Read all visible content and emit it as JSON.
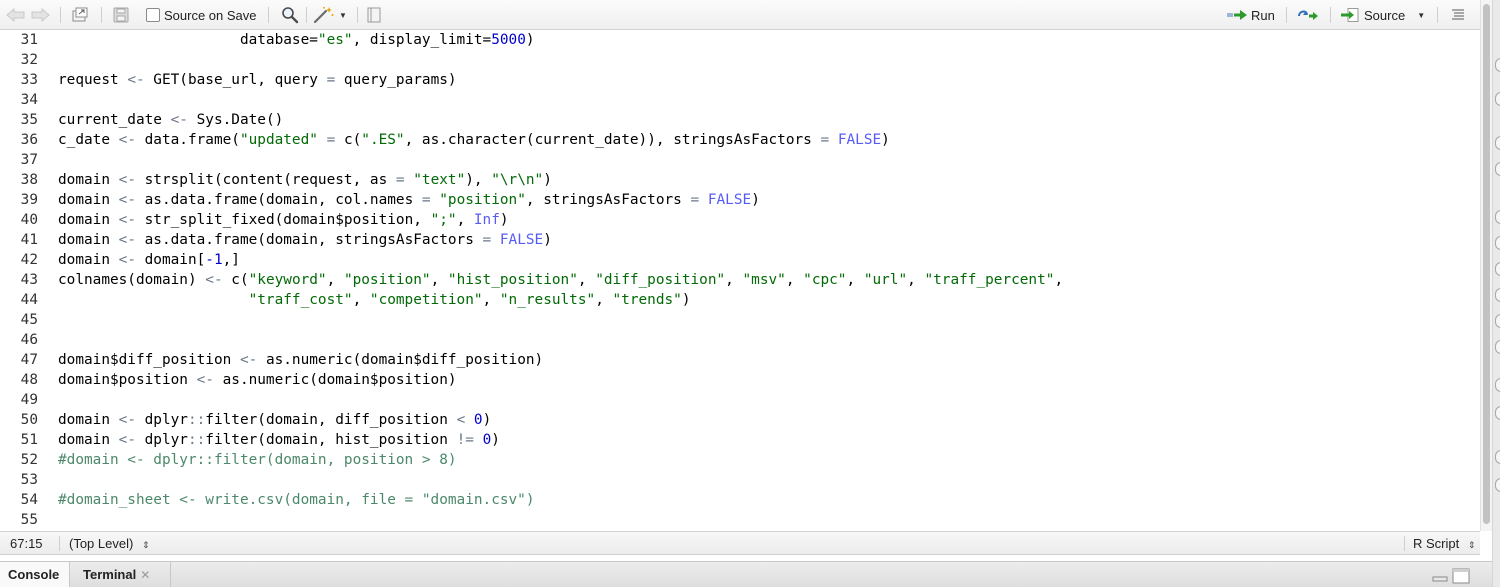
{
  "toolbar": {
    "source_on_save_label": "Source on Save",
    "run_label": "Run",
    "source_label": "Source"
  },
  "editor": {
    "lines": [
      {
        "n": "31",
        "tokens": [
          [
            "",
            "                     database="
          ],
          [
            "str",
            "\"es\""
          ],
          [
            "",
            ", display_limit="
          ],
          [
            "num",
            "5000"
          ],
          [
            "",
            ")"
          ]
        ]
      },
      {
        "n": "32",
        "tokens": []
      },
      {
        "n": "33",
        "tokens": [
          [
            "",
            "request "
          ],
          [
            "op",
            "<-"
          ],
          [
            "",
            " GET(base_url, query "
          ],
          [
            "op",
            "="
          ],
          [
            "",
            " query_params)"
          ]
        ]
      },
      {
        "n": "34",
        "tokens": []
      },
      {
        "n": "35",
        "tokens": [
          [
            "",
            "current_date "
          ],
          [
            "op",
            "<-"
          ],
          [
            "",
            " Sys.Date()"
          ]
        ]
      },
      {
        "n": "36",
        "tokens": [
          [
            "",
            "c_date "
          ],
          [
            "op",
            "<-"
          ],
          [
            "",
            " data.frame("
          ],
          [
            "str",
            "\"updated\""
          ],
          [
            "",
            " "
          ],
          [
            "op",
            "="
          ],
          [
            "",
            " c("
          ],
          [
            "str",
            "\".ES\""
          ],
          [
            "",
            ", as.character(current_date)), stringsAsFactors "
          ],
          [
            "op",
            "="
          ],
          [
            "",
            " "
          ],
          [
            "const",
            "FALSE"
          ],
          [
            "",
            ")"
          ]
        ]
      },
      {
        "n": "37",
        "tokens": []
      },
      {
        "n": "38",
        "tokens": [
          [
            "",
            "domain "
          ],
          [
            "op",
            "<-"
          ],
          [
            "",
            " strsplit(content(request, as "
          ],
          [
            "op",
            "="
          ],
          [
            "",
            " "
          ],
          [
            "str",
            "\"text\""
          ],
          [
            "",
            "), "
          ],
          [
            "str",
            "\"\\r\\n\""
          ],
          [
            "",
            ")"
          ]
        ]
      },
      {
        "n": "39",
        "tokens": [
          [
            "",
            "domain "
          ],
          [
            "op",
            "<-"
          ],
          [
            "",
            " as.data.frame(domain, col.names "
          ],
          [
            "op",
            "="
          ],
          [
            "",
            " "
          ],
          [
            "str",
            "\"position\""
          ],
          [
            "",
            ", stringsAsFactors "
          ],
          [
            "op",
            "="
          ],
          [
            "",
            " "
          ],
          [
            "const",
            "FALSE"
          ],
          [
            "",
            ")"
          ]
        ]
      },
      {
        "n": "40",
        "tokens": [
          [
            "",
            "domain "
          ],
          [
            "op",
            "<-"
          ],
          [
            "",
            " str_split_fixed(domain$position, "
          ],
          [
            "str",
            "\";\""
          ],
          [
            "",
            ", "
          ],
          [
            "const",
            "Inf"
          ],
          [
            "",
            ")"
          ]
        ]
      },
      {
        "n": "41",
        "tokens": [
          [
            "",
            "domain "
          ],
          [
            "op",
            "<-"
          ],
          [
            "",
            " as.data.frame(domain, stringsAsFactors "
          ],
          [
            "op",
            "="
          ],
          [
            "",
            " "
          ],
          [
            "const",
            "FALSE"
          ],
          [
            "",
            ")"
          ]
        ]
      },
      {
        "n": "42",
        "tokens": [
          [
            "",
            "domain "
          ],
          [
            "op",
            "<-"
          ],
          [
            "",
            " domain["
          ],
          [
            "num",
            "-1"
          ],
          [
            "",
            ",]"
          ]
        ]
      },
      {
        "n": "43",
        "tokens": [
          [
            "",
            "colnames(domain) "
          ],
          [
            "op",
            "<-"
          ],
          [
            "",
            " c("
          ],
          [
            "str",
            "\"keyword\""
          ],
          [
            "",
            ", "
          ],
          [
            "str",
            "\"position\""
          ],
          [
            "",
            ", "
          ],
          [
            "str",
            "\"hist_position\""
          ],
          [
            "",
            ", "
          ],
          [
            "str",
            "\"diff_position\""
          ],
          [
            "",
            ", "
          ],
          [
            "str",
            "\"msv\""
          ],
          [
            "",
            ", "
          ],
          [
            "str",
            "\"cpc\""
          ],
          [
            "",
            ", "
          ],
          [
            "str",
            "\"url\""
          ],
          [
            "",
            ", "
          ],
          [
            "str",
            "\"traff_percent\""
          ],
          [
            "",
            ","
          ]
        ]
      },
      {
        "n": "44",
        "tokens": [
          [
            "",
            "                      "
          ],
          [
            "str",
            "\"traff_cost\""
          ],
          [
            "",
            ", "
          ],
          [
            "str",
            "\"competition\""
          ],
          [
            "",
            ", "
          ],
          [
            "str",
            "\"n_results\""
          ],
          [
            "",
            ", "
          ],
          [
            "str",
            "\"trends\""
          ],
          [
            "",
            ")"
          ]
        ]
      },
      {
        "n": "45",
        "tokens": []
      },
      {
        "n": "46",
        "tokens": []
      },
      {
        "n": "47",
        "tokens": [
          [
            "",
            "domain$diff_position "
          ],
          [
            "op",
            "<-"
          ],
          [
            "",
            " as.numeric(domain$diff_position)"
          ]
        ]
      },
      {
        "n": "48",
        "tokens": [
          [
            "",
            "domain$position "
          ],
          [
            "op",
            "<-"
          ],
          [
            "",
            " as.numeric(domain$position)"
          ]
        ]
      },
      {
        "n": "49",
        "tokens": []
      },
      {
        "n": "50",
        "tokens": [
          [
            "",
            "domain "
          ],
          [
            "op",
            "<-"
          ],
          [
            "",
            " dplyr"
          ],
          [
            "op",
            "::"
          ],
          [
            "",
            "filter(domain, diff_position "
          ],
          [
            "op",
            "<"
          ],
          [
            "",
            " "
          ],
          [
            "num",
            "0"
          ],
          [
            "",
            ")"
          ]
        ]
      },
      {
        "n": "51",
        "tokens": [
          [
            "",
            "domain "
          ],
          [
            "op",
            "<-"
          ],
          [
            "",
            " dplyr"
          ],
          [
            "op",
            "::"
          ],
          [
            "",
            "filter(domain, hist_position "
          ],
          [
            "op",
            "!="
          ],
          [
            "",
            " "
          ],
          [
            "num",
            "0"
          ],
          [
            "",
            ")"
          ]
        ]
      },
      {
        "n": "52",
        "tokens": [
          [
            "cmt",
            "#domain <- dplyr::filter(domain, position > 8)"
          ]
        ]
      },
      {
        "n": "53",
        "tokens": []
      },
      {
        "n": "54",
        "tokens": [
          [
            "cmt",
            "#domain_sheet <- write.csv(domain, file = \"domain.csv\")"
          ]
        ]
      },
      {
        "n": "55",
        "tokens": []
      }
    ]
  },
  "status": {
    "cursor_position": "67:15",
    "scope": "(Top Level)",
    "file_type": "R Script"
  },
  "console_tabs": {
    "console": "Console",
    "terminal": "Terminal"
  }
}
